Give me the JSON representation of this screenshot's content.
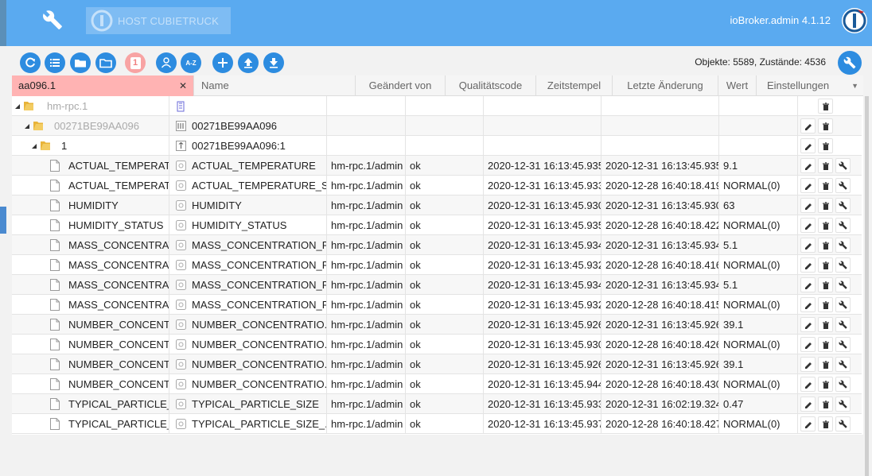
{
  "header": {
    "host_label": "HOST CUBIETRUCK",
    "brand": "ioBroker.admin 4.1.12"
  },
  "toolbar": {
    "counts": "Objekte: 5589, Zustände: 4536",
    "pink_button_label": "1",
    "sort_label": "A-Z"
  },
  "table": {
    "search_value": "aa096.1",
    "search_clear": "✕",
    "columns": {
      "name": "Name",
      "changed_by": "Geändert von",
      "quality": "Qualitätscode",
      "timestamp": "Zeitstempel",
      "last_change": "Letzte Änderung",
      "value": "Wert",
      "settings": "Einstellungen"
    },
    "rows": [
      {
        "id": "hm-rpc.1",
        "name": "",
        "from": "",
        "q": "",
        "ts": "",
        "lc": "",
        "val": ""
      },
      {
        "id": "00271BE99AA096",
        "name": "00271BE99AA096",
        "from": "",
        "q": "",
        "ts": "",
        "lc": "",
        "val": ""
      },
      {
        "id": "1",
        "name": "00271BE99AA096:1",
        "from": "",
        "q": "",
        "ts": "",
        "lc": "",
        "val": ""
      },
      {
        "id": "ACTUAL_TEMPERATU",
        "name": "ACTUAL_TEMPERATURE",
        "from": "hm-rpc.1/admin",
        "q": "ok",
        "ts": "2020-12-31 16:13:45.935",
        "lc": "2020-12-31 16:13:45.935",
        "val": "9.1"
      },
      {
        "id": "ACTUAL_TEMPERATU",
        "name": "ACTUAL_TEMPERATURE_S...",
        "from": "hm-rpc.1/admin",
        "q": "ok",
        "ts": "2020-12-31 16:13:45.933",
        "lc": "2020-12-28 16:40:18.419",
        "val": "NORMAL(0)"
      },
      {
        "id": "HUMIDITY",
        "name": "HUMIDITY",
        "from": "hm-rpc.1/admin",
        "q": "ok",
        "ts": "2020-12-31 16:13:45.930",
        "lc": "2020-12-31 16:13:45.930",
        "val": "63"
      },
      {
        "id": "HUMIDITY_STATUS",
        "name": "HUMIDITY_STATUS",
        "from": "hm-rpc.1/admin",
        "q": "ok",
        "ts": "2020-12-31 16:13:45.935",
        "lc": "2020-12-28 16:40:18.422",
        "val": "NORMAL(0)"
      },
      {
        "id": "MASS_CONCENTRATI",
        "name": "MASS_CONCENTRATION_P...",
        "from": "hm-rpc.1/admin",
        "q": "ok",
        "ts": "2020-12-31 16:13:45.934",
        "lc": "2020-12-31 16:13:45.934",
        "val": "5.1"
      },
      {
        "id": "MASS_CONCENTRATI",
        "name": "MASS_CONCENTRATION_P...",
        "from": "hm-rpc.1/admin",
        "q": "ok",
        "ts": "2020-12-31 16:13:45.932",
        "lc": "2020-12-28 16:40:18.416",
        "val": "NORMAL(0)"
      },
      {
        "id": "MASS_CONCENTRATI",
        "name": "MASS_CONCENTRATION_P...",
        "from": "hm-rpc.1/admin",
        "q": "ok",
        "ts": "2020-12-31 16:13:45.934",
        "lc": "2020-12-31 16:13:45.934",
        "val": "5.1"
      },
      {
        "id": "MASS_CONCENTRATI",
        "name": "MASS_CONCENTRATION_P...",
        "from": "hm-rpc.1/admin",
        "q": "ok",
        "ts": "2020-12-31 16:13:45.932",
        "lc": "2020-12-28 16:40:18.415",
        "val": "NORMAL(0)"
      },
      {
        "id": "NUMBER_CONCENTRA",
        "name": "NUMBER_CONCENTRATIO...",
        "from": "hm-rpc.1/admin",
        "q": "ok",
        "ts": "2020-12-31 16:13:45.926",
        "lc": "2020-12-31 16:13:45.926",
        "val": "39.1"
      },
      {
        "id": "NUMBER_CONCENTRA",
        "name": "NUMBER_CONCENTRATIO...",
        "from": "hm-rpc.1/admin",
        "q": "ok",
        "ts": "2020-12-31 16:13:45.930",
        "lc": "2020-12-28 16:40:18.426",
        "val": "NORMAL(0)"
      },
      {
        "id": "NUMBER_CONCENTRA",
        "name": "NUMBER_CONCENTRATIO...",
        "from": "hm-rpc.1/admin",
        "q": "ok",
        "ts": "2020-12-31 16:13:45.926",
        "lc": "2020-12-31 16:13:45.926",
        "val": "39.1"
      },
      {
        "id": "NUMBER_CONCENTRA",
        "name": "NUMBER_CONCENTRATIO...",
        "from": "hm-rpc.1/admin",
        "q": "ok",
        "ts": "2020-12-31 16:13:45.944",
        "lc": "2020-12-28 16:40:18.430",
        "val": "NORMAL(0)"
      },
      {
        "id": "TYPICAL_PARTICLE_S",
        "name": "TYPICAL_PARTICLE_SIZE",
        "from": "hm-rpc.1/admin",
        "q": "ok",
        "ts": "2020-12-31 16:13:45.933",
        "lc": "2020-12-31 16:02:19.324",
        "val": "0.47"
      },
      {
        "id": "TYPICAL_PARTICLE_S",
        "name": "TYPICAL_PARTICLE_SIZE_...",
        "from": "hm-rpc.1/admin",
        "q": "ok",
        "ts": "2020-12-31 16:13:45.937",
        "lc": "2020-12-28 16:40:18.427",
        "val": "NORMAL(0)"
      }
    ]
  },
  "colors": {
    "topbar": "#5aaaf0",
    "button": "#2d8ce0",
    "search_bg": "#ffb3b3",
    "folder": "#e8b43a"
  }
}
